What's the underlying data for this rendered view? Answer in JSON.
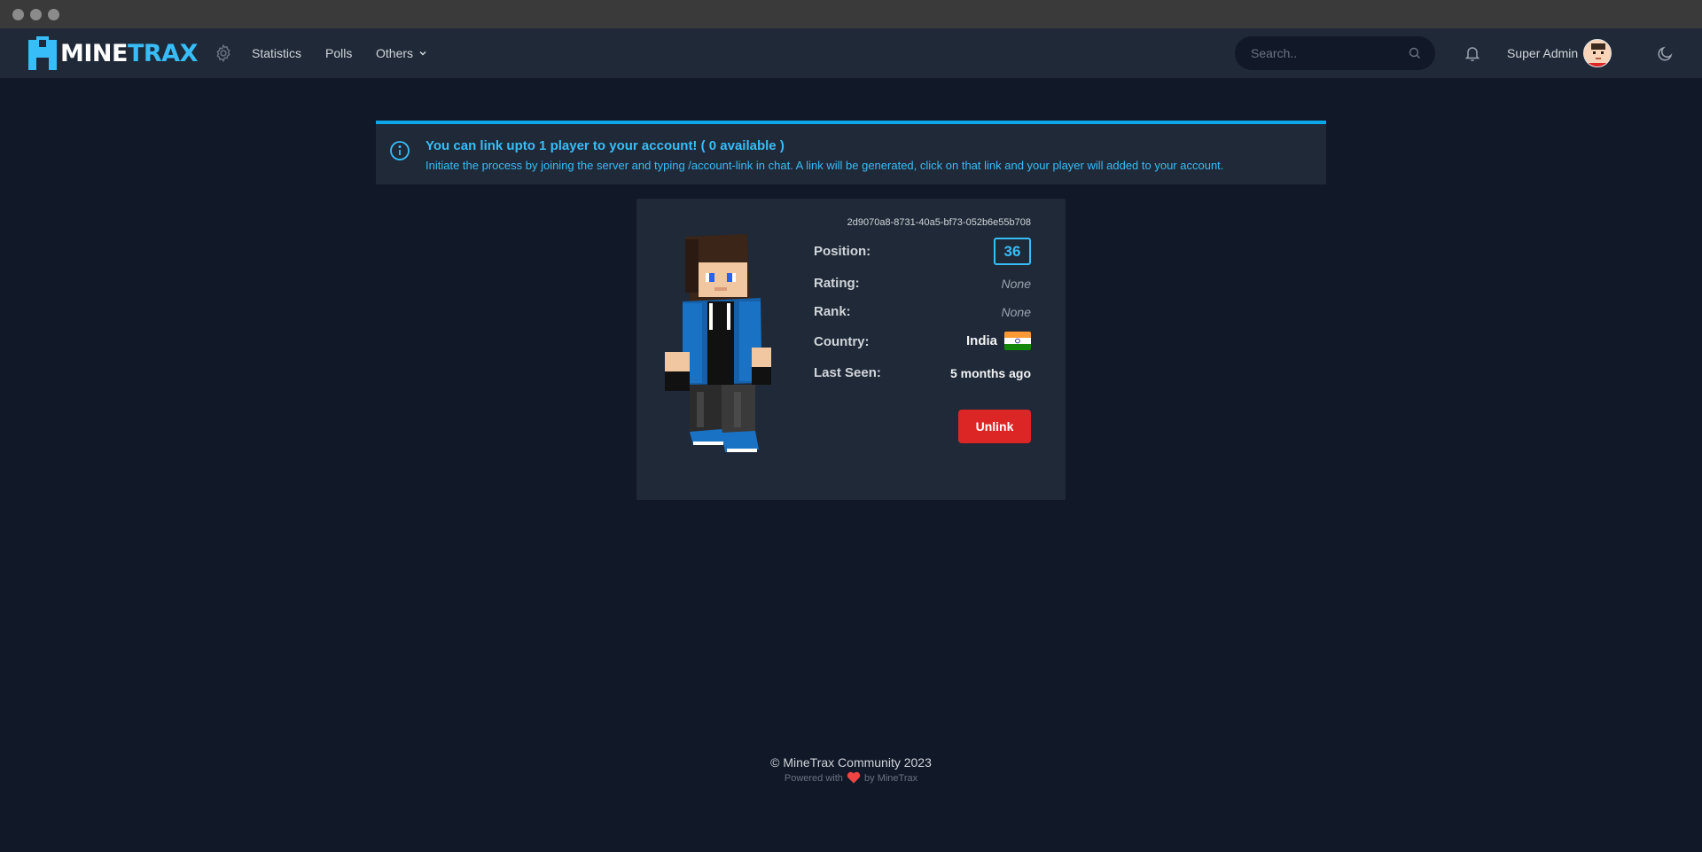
{
  "brand": {
    "part1": "MINE",
    "part2": "TRAX",
    "accent": "#38bdf8"
  },
  "nav": {
    "statistics": "Statistics",
    "polls": "Polls",
    "others": "Others"
  },
  "search": {
    "placeholder": "Search.."
  },
  "user": {
    "name": "Super Admin"
  },
  "alert": {
    "title": "You can link upto 1 player to your account! ( 0 available )",
    "text": "Initiate the process by joining the server and typing /account-link in chat. A link will be generated, click on that link and your player will added to your account."
  },
  "player": {
    "uuid": "2d9070a8-8731-40a5-bf73-052b6e55b708",
    "position_label": "Position:",
    "position": "36",
    "rating_label": "Rating:",
    "rating": "None",
    "rank_label": "Rank:",
    "rank": "None",
    "country_label": "Country:",
    "country": "India",
    "last_seen_label": "Last Seen:",
    "last_seen": "5 months ago",
    "unlink_label": "Unlink"
  },
  "footer": {
    "copyright": "© MineTrax Community 2023",
    "powered_prefix": "Powered with",
    "powered_suffix": "by MineTrax"
  },
  "colors": {
    "background": "#111827",
    "panel": "#1f2937",
    "danger": "#dc2626"
  }
}
